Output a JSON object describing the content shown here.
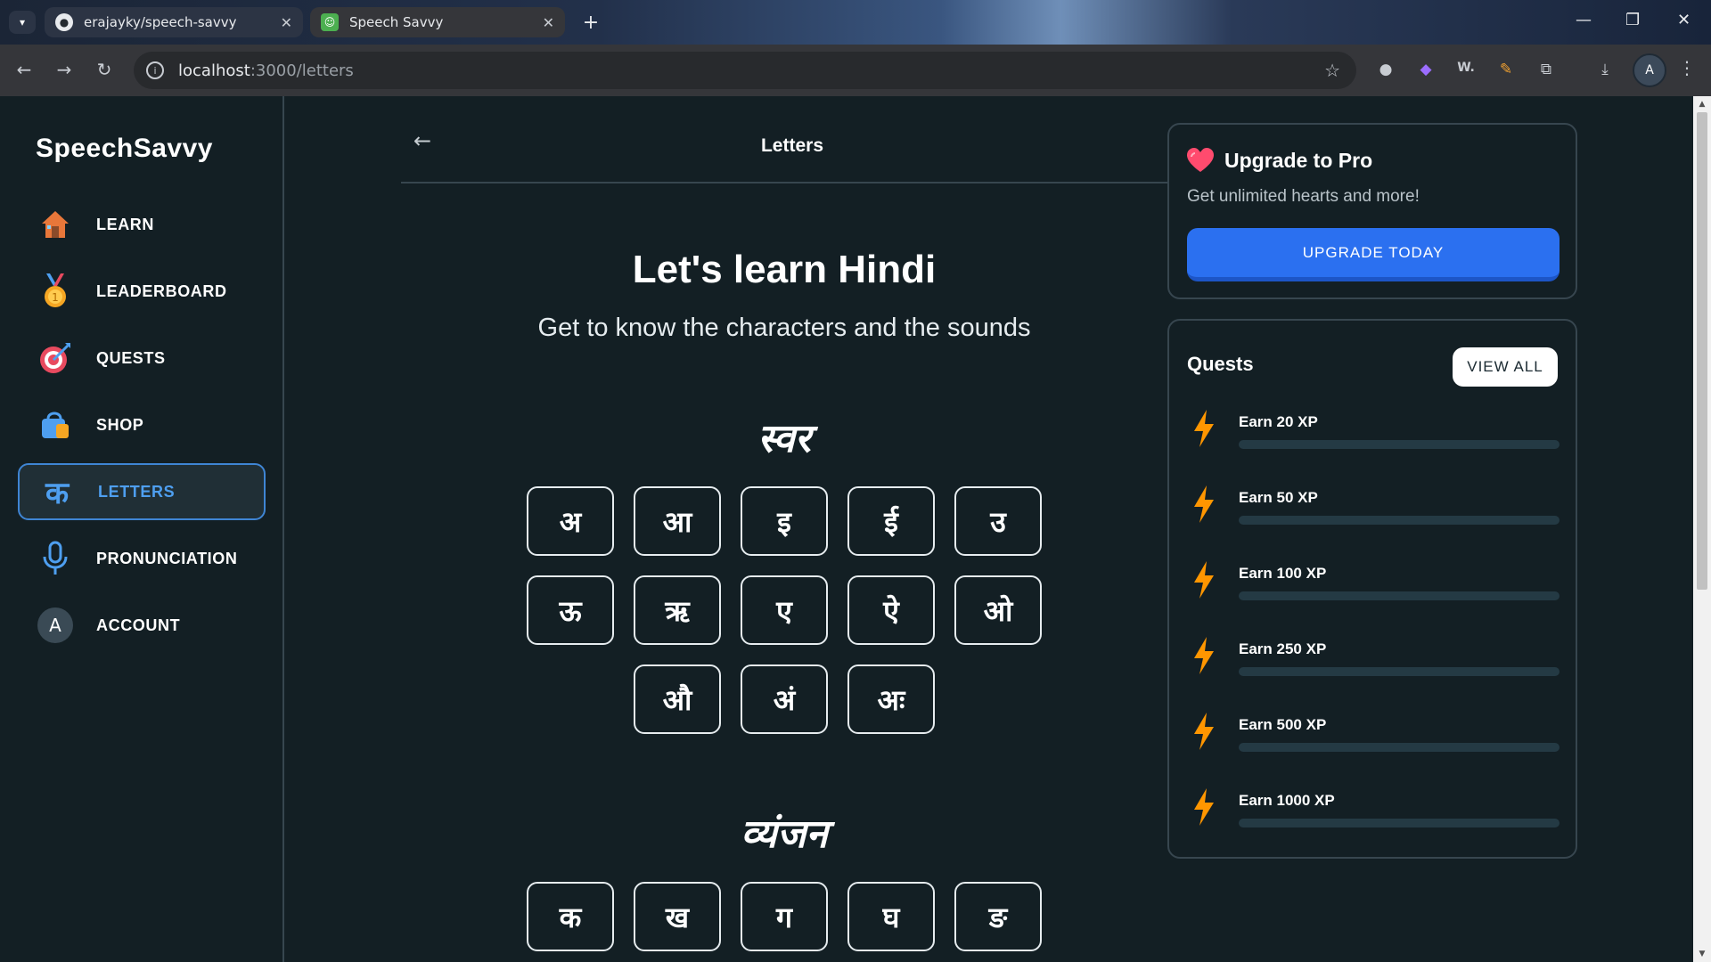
{
  "browser": {
    "tabs": [
      {
        "title": "erajayky/speech-savvy",
        "icon": "github-icon",
        "active": false
      },
      {
        "title": "Speech Savvy",
        "icon": "speech-savvy-favicon",
        "active": true
      }
    ],
    "url_host": "localhost",
    "url_path": ":3000/letters",
    "profile_initial": "A"
  },
  "sidebar": {
    "brand": "SpeechSavvy",
    "items": [
      {
        "label": "LEARN",
        "icon": "house-icon",
        "active": false
      },
      {
        "label": "LEADERBOARD",
        "icon": "medal-icon",
        "active": false
      },
      {
        "label": "QUESTS",
        "icon": "target-icon",
        "active": false
      },
      {
        "label": "SHOP",
        "icon": "shopping-bag-icon",
        "active": false
      },
      {
        "label": "LETTERS",
        "icon": "ka-letter-icon",
        "glyph": "क",
        "active": true
      },
      {
        "label": "PRONUNCIATION",
        "icon": "microphone-icon",
        "active": false
      },
      {
        "label": "ACCOUNT",
        "icon": "avatar-icon",
        "glyph": "A",
        "active": false
      }
    ]
  },
  "main": {
    "header_title": "Letters",
    "hero_title": "Let's learn Hindi",
    "hero_subtitle": "Get to know the characters and the sounds",
    "vowels_title": "स्वर",
    "vowels": [
      [
        "अ",
        "आ",
        "इ",
        "ई",
        "उ"
      ],
      [
        "ऊ",
        "ऋ",
        "ए",
        "ऐ",
        "ओ"
      ],
      [
        "औ",
        "अं",
        "अः"
      ]
    ],
    "consonants_title": "व्यंजन",
    "consonants": [
      [
        "क",
        "ख",
        "ग",
        "घ",
        "ङ"
      ]
    ]
  },
  "promo": {
    "title": "Upgrade to Pro",
    "subtitle": "Get unlimited hearts and more!",
    "button": "UPGRADE TODAY"
  },
  "quests": {
    "title": "Quests",
    "view_all": "VIEW ALL",
    "items": [
      {
        "label": "Earn 20 XP",
        "progress": 0
      },
      {
        "label": "Earn 50 XP",
        "progress": 0
      },
      {
        "label": "Earn 100 XP",
        "progress": 0
      },
      {
        "label": "Earn 250 XP",
        "progress": 0
      },
      {
        "label": "Earn 500 XP",
        "progress": 0
      },
      {
        "label": "Earn 1000 XP",
        "progress": 0
      }
    ]
  },
  "colors": {
    "background": "#131f24",
    "border": "#37464f",
    "accent_blue": "#2b70f0",
    "active_nav": "#4e9ff0",
    "bolt_orange": "#ff9600"
  }
}
